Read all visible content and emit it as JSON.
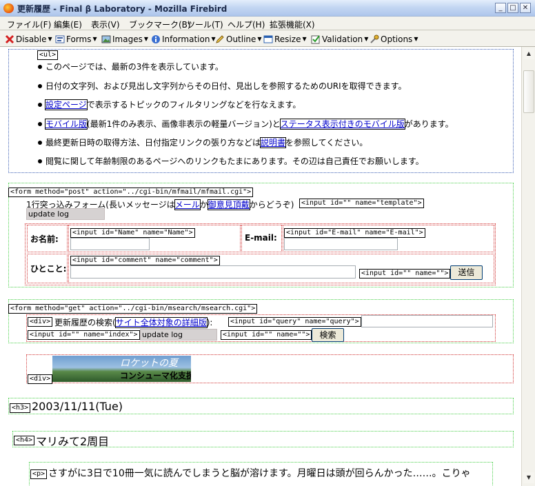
{
  "window": {
    "title": "更新履歴 - Final β Laboratory - Mozilla Firebird"
  },
  "menu": [
    "ファイル(F)",
    "編集(E)",
    "表示(V)",
    "ブックマーク(B)",
    "ツール(T)",
    "ヘルプ(H)",
    "拡張機能(X)"
  ],
  "toolbar": [
    "Disable",
    "Forms",
    "Images",
    "Information",
    "Outline",
    "Resize",
    "Validation",
    "Options"
  ],
  "tags": {
    "ul": "<ul>",
    "form1": "<form method=\"post\" action=\"../cgi-bin/mfmail/mfmail.cgi\">",
    "input_template": "<input id=\"\" name=\"template\">",
    "input_name": "<input id=\"Name\" name=\"Name\">",
    "input_email": "<input id=\"E-mail\" name=\"E-mail\">",
    "input_comment": "<input id=\"comment\" name=\"comment\">",
    "input_empty": "<input id=\"\" name=\"\">",
    "form2": "<form method=\"get\" action=\"../cgi-bin/msearch/msearch.cgi\">",
    "div": "<div>",
    "input_query": "<input id=\"query\" name=\"query\">",
    "input_index": "<input id=\"\" name=\"index\">",
    "h3": "<h3>",
    "h4": "<h4>",
    "p": "<p>"
  },
  "list": {
    "item1": "このページでは、最新の3件を表示しています。",
    "item2": "日付の文字列、および見出し文字列からその日付、見出しを参照するためのURIを取得できます。",
    "item3_link": "設定ページ",
    "item3_rest": "で表示するトピックのフィルタリングなどを行なえます。",
    "item4_link1": "モバイル版",
    "item4_mid": "(最新1件のみ表示、画像非表示の軽量バージョン)と",
    "item4_link2": "ステータス表示付きのモバイル版",
    "item4_rest": "があります。",
    "item5_pre": "最終更新日時の取得方法、日付指定リンクの張り方などは",
    "item5_link": "説明書",
    "item5_rest": "を参照してください。",
    "item6": "閲覧に関して年齢制限のあるページへのリンクもたまにあります。その辺は自己責任でお願いします。"
  },
  "form1": {
    "intro_pre": "1行突っ込みフォーム(長いメッセージは",
    "link_mail": "メール",
    "intro_mid": "か",
    "link_opinion": "御意見頂戴",
    "intro_post": "からどうぞ)",
    "hidden_value": "update log",
    "name_label": "お名前:",
    "email_label": "E-mail:",
    "comment_label": "ひとこと:",
    "submit": "送信"
  },
  "form2": {
    "search_pre": "更新履歴の検索(",
    "search_link": "サイト全体対象の詳細版",
    "search_post": "):",
    "index_value": "update log",
    "button": "検索"
  },
  "banner": {
    "line1": "ロケットの夏",
    "line2": "コンシューマ化支援"
  },
  "date_heading": "2003/11/11(Tue)",
  "entry_heading": "マリみて2周目",
  "paragraph": "さすがに3日で10冊一気に読んでしまうと脳が溶けます。月曜日は頭が回らんかった……。こりゃ"
}
